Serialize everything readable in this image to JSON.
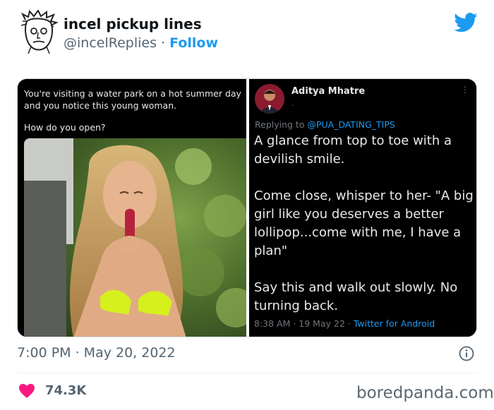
{
  "header": {
    "display_name": "incel pickup lines",
    "handle": "@incelReplies",
    "separator": " · ",
    "follow_label": "Follow",
    "avatar_icon": "sketch-face-avatar",
    "brand_icon": "twitter-bird-icon",
    "brand_color": "#1d9bf0"
  },
  "media": {
    "left": {
      "question": "You're visiting a water park on a hot summer day and you notice this young woman.",
      "ask": "How do you open?"
    },
    "right": {
      "author": "Aditya Mhatre",
      "author_sub": ".",
      "more": "⋮",
      "replying_prefix": "Replying to ",
      "replying_to": "@PUA_DATING_TIPS",
      "body": [
        "A glance from top to toe with a devilish smile.",
        "Come close, whisper to her- \"A big girl like you deserves a better lollipop...come with me, I have a plan\"",
        "Say this and walk out slowly. No turning back."
      ],
      "meta_time": "8:38 AM · 19 May 22 · ",
      "meta_source": "Twitter for Android"
    }
  },
  "footer": {
    "timestamp": "7:00 PM · May 20, 2022",
    "likes": "74.3K",
    "like_color": "#f91880",
    "watermark": "boredpanda.com"
  }
}
